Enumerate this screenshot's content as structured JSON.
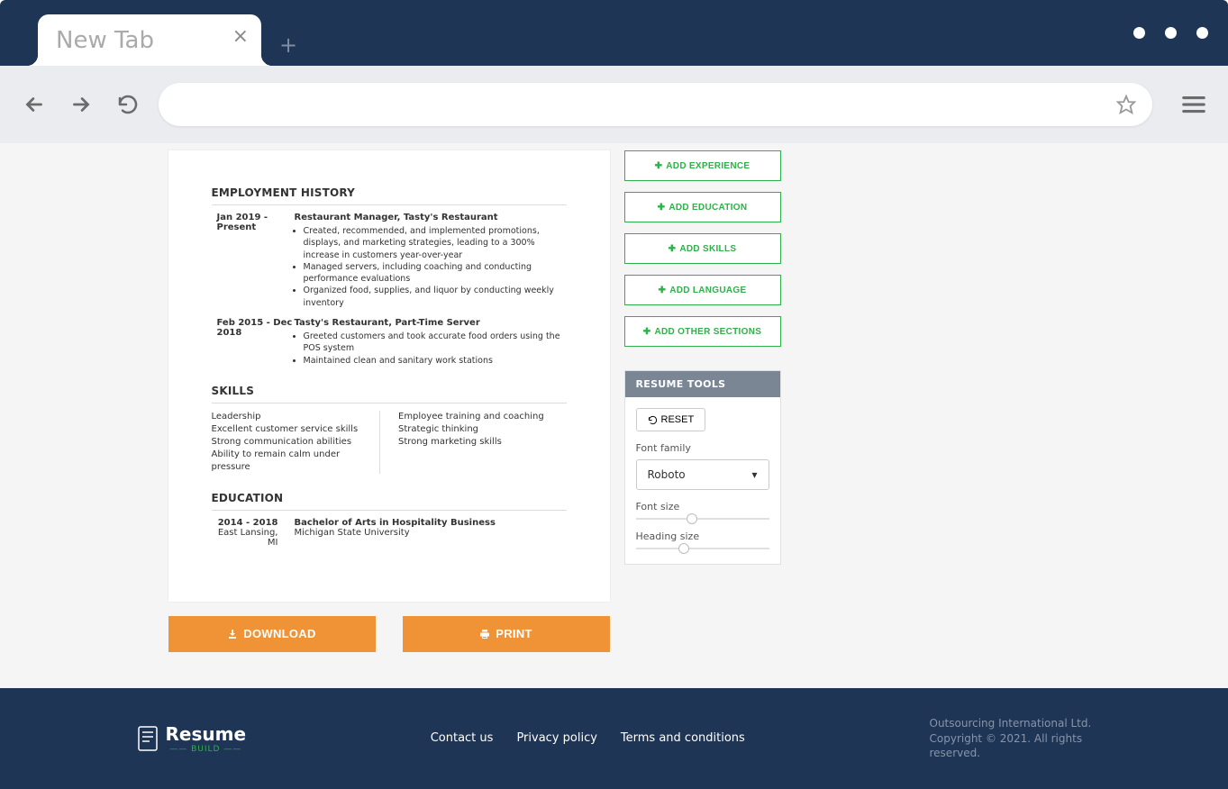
{
  "browser": {
    "tab_title": "New Tab",
    "url": ""
  },
  "resume": {
    "sections": {
      "employment": {
        "title": "EMPLOYMENT HISTORY",
        "items": [
          {
            "dates": "Jan 2019 - Present",
            "title": "Restaurant Manager, Tasty's Restaurant",
            "bullets": [
              "Created, recommended, and implemented promotions, displays, and marketing strategies, leading to a 300% increase in customers year-over-year",
              "Managed servers, including coaching and conducting performance evaluations",
              "Organized food, supplies, and liquor by conducting weekly inventory"
            ]
          },
          {
            "dates": "Feb 2015 - Dec 2018",
            "title": "Tasty's Restaurant, Part-Time Server",
            "bullets": [
              "Greeted customers and took accurate food orders using the POS system",
              "Maintained clean and sanitary work stations"
            ]
          }
        ]
      },
      "skills": {
        "title": "SKILLS",
        "left": [
          "Leadership",
          "Excellent customer service skills",
          "Strong communication abilities",
          "Ability to remain calm under pressure"
        ],
        "right": [
          "Employee training and coaching",
          "Strategic thinking",
          "Strong marketing skills"
        ]
      },
      "education": {
        "title": "EDUCATION",
        "items": [
          {
            "years": "2014 - 2018",
            "location": "East Lansing, MI",
            "degree": "Bachelor of Arts in Hospitality Business",
            "school": "Michigan State University"
          }
        ]
      }
    }
  },
  "actions": {
    "download": "DOWNLOAD",
    "print": "PRINT"
  },
  "sidebar": {
    "buttons": [
      "ADD EXPERIENCE",
      "ADD EDUCATION",
      "ADD SKILLS",
      "ADD LANGUAGE",
      "ADD OTHER SECTIONS"
    ],
    "tools": {
      "title": "RESUME TOOLS",
      "reset": "RESET",
      "font_family_label": "Font family",
      "font_family_value": "Roboto",
      "font_size_label": "Font size",
      "font_size_pos": 38,
      "heading_size_label": "Heading size",
      "heading_size_pos": 32
    }
  },
  "footer": {
    "logo": {
      "name": "Resume",
      "sub": "—— BUILD ——"
    },
    "links": [
      "Contact us",
      "Privacy policy",
      "Terms and conditions"
    ],
    "copyright": "Outsourcing International Ltd. Copyright © 2021. All rights reserved."
  }
}
